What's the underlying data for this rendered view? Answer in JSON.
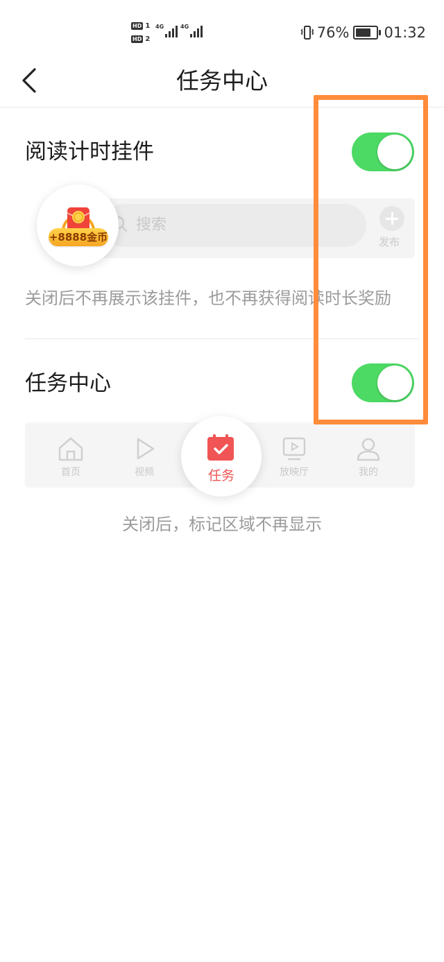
{
  "status_bar": {
    "sim1": {
      "badge": "HD",
      "num": "1"
    },
    "sim2": {
      "badge": "HD",
      "num": "2"
    },
    "network1": "4G",
    "network2": "4G",
    "battery_percent": "76%",
    "battery_level": 0.76,
    "time": "01:32"
  },
  "nav": {
    "title": "任务中心"
  },
  "settings": {
    "reading_timer": {
      "label": "阅读计时挂件",
      "enabled": true,
      "preview": {
        "coin_badge": "+8888金币",
        "search_placeholder": "搜索",
        "publish_label": "发布"
      },
      "description": "关闭后不再展示该挂件，也不再获得阅读时长奖励"
    },
    "task_center": {
      "label": "任务中心",
      "enabled": true,
      "preview_tabs": [
        {
          "label": "首页",
          "icon": "home-icon"
        },
        {
          "label": "视频",
          "icon": "play-icon"
        },
        {
          "label": "任务",
          "icon": "calendar-check-icon"
        },
        {
          "label": "放映厅",
          "icon": "screen-play-icon"
        },
        {
          "label": "我的",
          "icon": "user-icon"
        }
      ],
      "description": "关闭后，标记区域不再显示"
    }
  },
  "colors": {
    "toggle_on": "#4cd964",
    "highlight": "#ff8c3a",
    "task_accent": "#f05454"
  }
}
